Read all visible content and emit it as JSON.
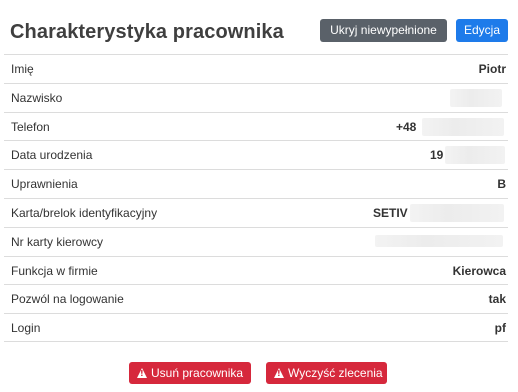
{
  "header": {
    "title": "Charakterystyka pracownika",
    "hide_empty_label": "Ukryj niewypełnione",
    "edit_label": "Edycja"
  },
  "fields": [
    {
      "label": "Imię",
      "value": "Piotr"
    },
    {
      "label": "Nazwisko",
      "value": ""
    },
    {
      "label": "Telefon",
      "value": "+48"
    },
    {
      "label": "Data urodzenia",
      "value": "19"
    },
    {
      "label": "Uprawnienia",
      "value": "B"
    },
    {
      "label": "Karta/brelok identyfikacyjny",
      "value": "SETIV"
    },
    {
      "label": "Nr karty kierowcy",
      "value": ""
    },
    {
      "label": "Funkcja w firmie",
      "value": "Kierowca"
    },
    {
      "label": "Pozwól na logowanie",
      "value": "tak"
    },
    {
      "label": "Login",
      "value": "pf"
    }
  ],
  "footer": {
    "delete_label": "Usuń pracownika",
    "clear_orders_label": "Wyczyść zlecenia"
  },
  "icons": {
    "warning": "warning-icon"
  },
  "colors": {
    "edit_button": "#1e7bea",
    "hide_button": "#5a6169",
    "danger_button": "#d6283c"
  }
}
